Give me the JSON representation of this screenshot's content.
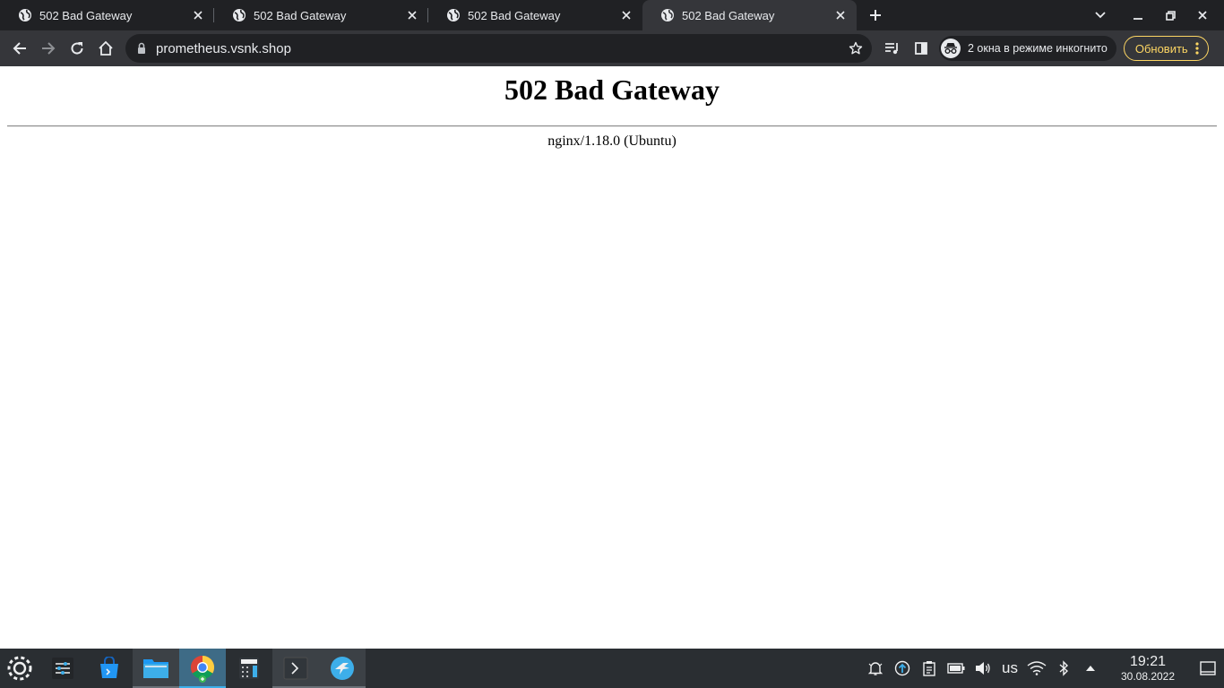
{
  "tabs": [
    {
      "title": "502 Bad Gateway"
    },
    {
      "title": "502 Bad Gateway"
    },
    {
      "title": "502 Bad Gateway"
    },
    {
      "title": "502 Bad Gateway"
    }
  ],
  "toolbar": {
    "url": "prometheus.vsnk.shop",
    "incognito_label": "2 окна в режиме инкогнито",
    "update_label": "Обновить"
  },
  "page": {
    "heading": "502 Bad Gateway",
    "server_info": "nginx/1.18.0 (Ubuntu)"
  },
  "taskbar": {
    "keyboard_layout": "us",
    "time": "19:21",
    "date": "30.08.2022"
  },
  "colors": {
    "tabstrip_bg": "#202124",
    "toolbar_bg": "#35363a",
    "update_accent": "#fdd663",
    "taskbar_bg": "#2a2e32",
    "taskbar_focus": "#3daee9"
  }
}
